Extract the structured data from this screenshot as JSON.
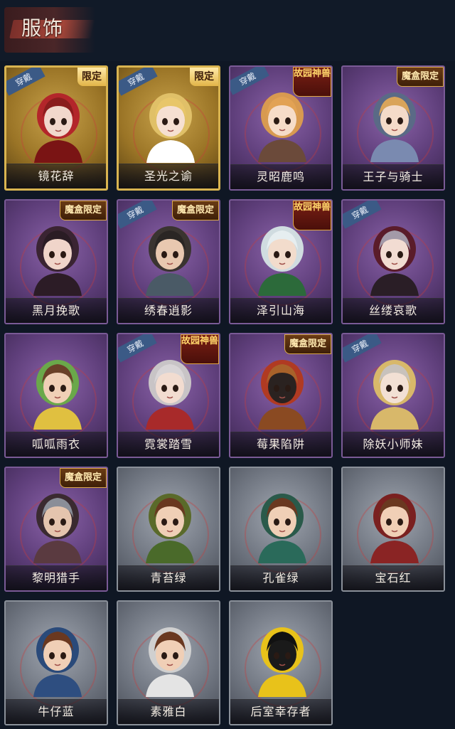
{
  "header": {
    "title": "服饰"
  },
  "tags": {
    "wear": "穿戴"
  },
  "costumes": [
    {
      "name": "镜花辞",
      "rarity": "gold",
      "badge": "limited",
      "badge_text": "限定",
      "worn": true,
      "hair": "#8a1d1d",
      "hood": "#b3262a",
      "skin": "#f1d8cc",
      "cloth": "#7a1414"
    },
    {
      "name": "圣光之谕",
      "rarity": "gold",
      "badge": "limited",
      "badge_text": "限定",
      "worn": true,
      "hair": "#e8c66a",
      "hood": "#e0c068",
      "skin": "#f6e0d2",
      "cloth": "#ffffff"
    },
    {
      "name": "灵昭鹿鸣",
      "rarity": "purple",
      "badge": "myth",
      "badge_text": "故园神兽",
      "worn": true,
      "hair": "#e2a254",
      "hood": "#d89a50",
      "skin": "#f6dcc8",
      "cloth": "#6b4a3a"
    },
    {
      "name": "王子与骑士",
      "rarity": "purple",
      "badge": "box",
      "badge_text": "魔盒限定",
      "worn": false,
      "hair": "#d9a45a",
      "hood": "#5a6a86",
      "skin": "#f4dbc9",
      "cloth": "#7a8ab0"
    },
    {
      "name": "黑月挽歌",
      "rarity": "purple",
      "badge": "box",
      "badge_text": "魔盒限定",
      "worn": false,
      "hair": "#2a1c24",
      "hood": "#3a2432",
      "skin": "#f0d5ca",
      "cloth": "#2c1c26"
    },
    {
      "name": "绣春逍影",
      "rarity": "purple",
      "badge": "box",
      "badge_text": "魔盒限定",
      "worn": true,
      "hair": "#2a2624",
      "hood": "#3a3430",
      "skin": "#e8c8b0",
      "cloth": "#4a5a66"
    },
    {
      "name": "泽引山海",
      "rarity": "purple",
      "badge": "myth",
      "badge_text": "故园神兽",
      "worn": false,
      "hair": "#e6eef0",
      "hood": "#d0dce0",
      "skin": "#f2dccc",
      "cloth": "#2c6a3a"
    },
    {
      "name": "丝缕哀歌",
      "rarity": "purple",
      "badge": "none",
      "badge_text": "",
      "worn": true,
      "hair": "#a39aa8",
      "hood": "#5a1c2a",
      "skin": "#f2dcd2",
      "cloth": "#2a1e26"
    },
    {
      "name": "呱呱雨衣",
      "rarity": "purple",
      "badge": "none",
      "badge_text": "",
      "worn": false,
      "hair": "#6a4028",
      "hood": "#6aa84a",
      "skin": "#f0cfb6",
      "cloth": "#e0c040"
    },
    {
      "name": "霓裳踏雪",
      "rarity": "purple",
      "badge": "myth",
      "badge_text": "故园神兽",
      "worn": true,
      "hair": "#d8d4d6",
      "hood": "#c8c4c6",
      "skin": "#f2dcd0",
      "cloth": "#a82a2a"
    },
    {
      "name": "莓果陷阱",
      "rarity": "purple",
      "badge": "box",
      "badge_text": "魔盒限定",
      "worn": false,
      "hair": "#a8622a",
      "hood": "#b03a22",
      "skin": "#2a2220",
      "cloth": "#8a4a22"
    },
    {
      "name": "除妖小师妹",
      "rarity": "purple",
      "badge": "none",
      "badge_text": "",
      "worn": true,
      "hair": "#c8c2bc",
      "hood": "#d8b86a",
      "skin": "#f2e0d4",
      "cloth": "#d8b86a"
    },
    {
      "name": "黎明猎手",
      "rarity": "purple",
      "badge": "box",
      "badge_text": "魔盒限定",
      "worn": false,
      "hair": "#8a8e98",
      "hood": "#3a2a30",
      "skin": "#e4c4ae",
      "cloth": "#5a3a40"
    },
    {
      "name": "青苔绿",
      "rarity": "gray",
      "badge": "none",
      "badge_text": "",
      "worn": false,
      "hair": "#6a3820",
      "hood": "#5a6a2a",
      "skin": "#f0cfb6",
      "cloth": "#4a6a2a"
    },
    {
      "name": "孔雀绿",
      "rarity": "gray",
      "badge": "none",
      "badge_text": "",
      "worn": false,
      "hair": "#6a3820",
      "hood": "#2a5a4a",
      "skin": "#f0cfb6",
      "cloth": "#2a6a5a"
    },
    {
      "name": "宝石红",
      "rarity": "gray",
      "badge": "none",
      "badge_text": "",
      "worn": false,
      "hair": "#6a3820",
      "hood": "#7a2020",
      "skin": "#f0cfb6",
      "cloth": "#8a2424"
    },
    {
      "name": "牛仔蓝",
      "rarity": "gray",
      "badge": "none",
      "badge_text": "",
      "worn": false,
      "hair": "#6a3820",
      "hood": "#2a4a7a",
      "skin": "#f0cfb6",
      "cloth": "#2e4e80"
    },
    {
      "name": "素雅白",
      "rarity": "gray",
      "badge": "none",
      "badge_text": "",
      "worn": false,
      "hair": "#6a3820",
      "hood": "#d0d0d0",
      "skin": "#f0cfb6",
      "cloth": "#e4e4e4"
    },
    {
      "name": "后室幸存者",
      "rarity": "gray",
      "badge": "none",
      "badge_text": "",
      "worn": false,
      "hair": "#111111",
      "hood": "#e8c21a",
      "skin": "#1a1a1a",
      "cloth": "#e8c21a"
    }
  ]
}
